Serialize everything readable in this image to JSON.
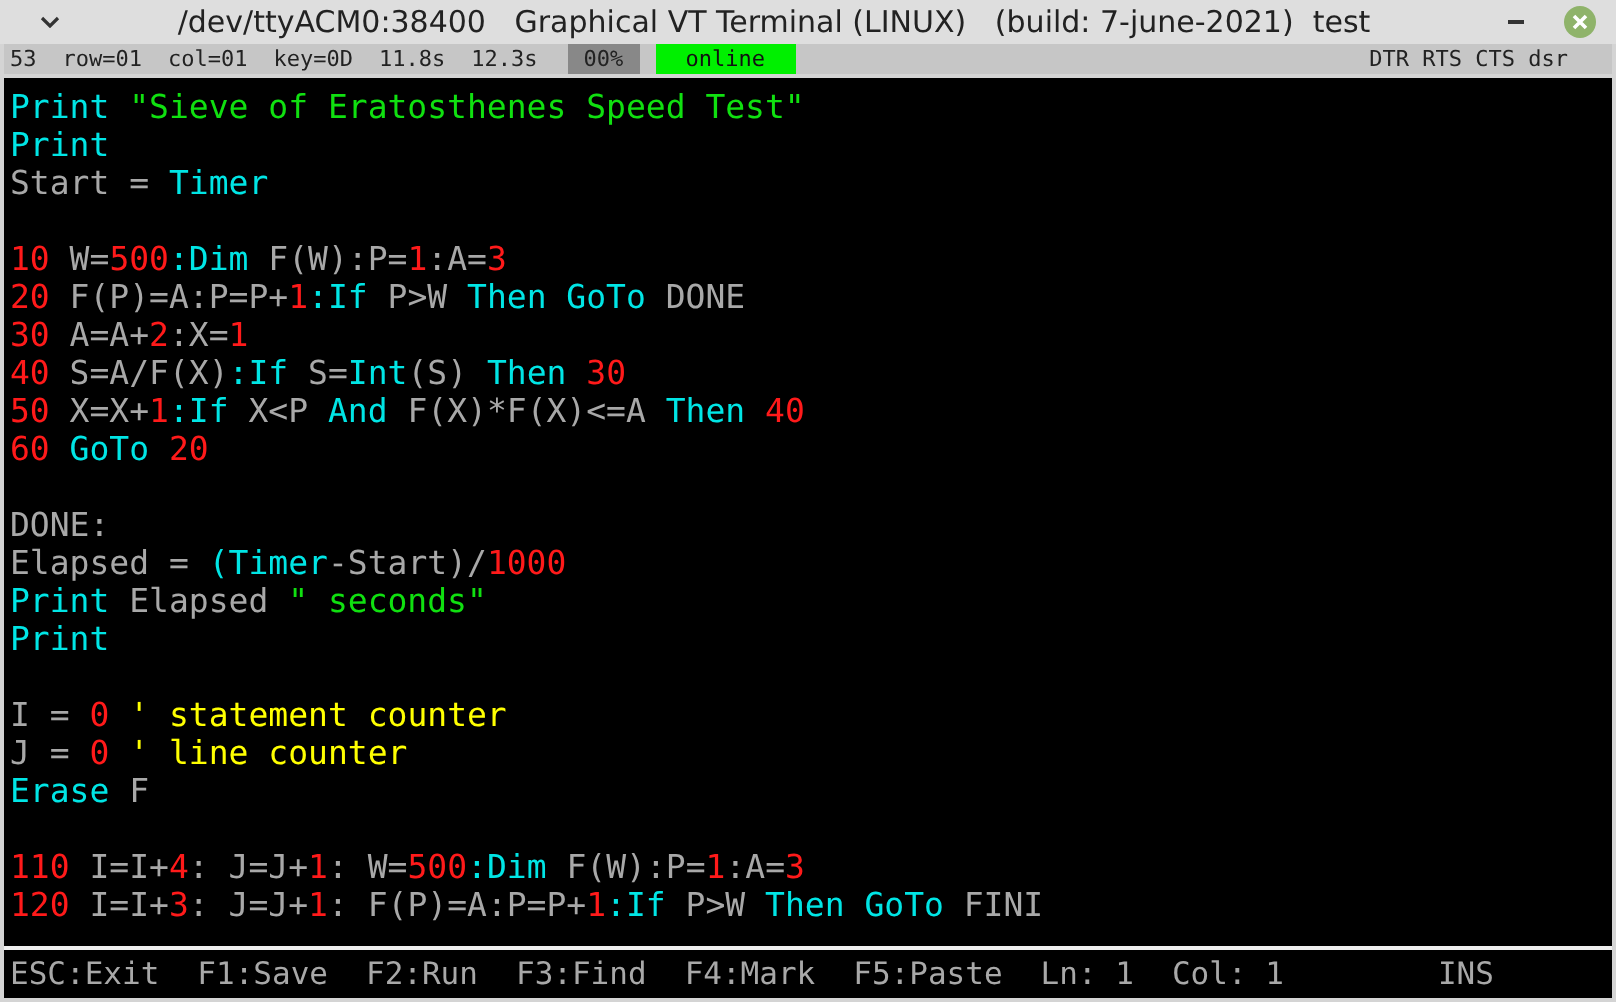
{
  "window": {
    "title": "/dev/ttyACM0:38400   Graphical VT Terminal (LINUX)   (build: 7-june-2021)  test"
  },
  "status_bar": {
    "fields": [
      "53",
      "row=01",
      "col=01",
      "key=0D",
      "11.8s",
      "12.3s"
    ],
    "progress": "00%",
    "connection": "online",
    "signals": "DTR RTS CTS dsr"
  },
  "editor": {
    "blocks": [
      {
        "lines": [
          [
            {
              "text": "Print ",
              "kind": "keyword"
            },
            {
              "text": "\"Sieve of Eratosthenes Speed Test\"",
              "kind": "string"
            }
          ],
          [
            {
              "text": "Print",
              "kind": "keyword"
            }
          ],
          [
            {
              "text": "Start = ",
              "kind": "plain"
            },
            {
              "text": "Timer",
              "kind": "keyword"
            }
          ]
        ]
      },
      {
        "lines": [
          [
            {
              "text": "10",
              "kind": "number"
            },
            {
              "text": " W=",
              "kind": "plain"
            },
            {
              "text": "500",
              "kind": "number"
            },
            {
              "text": ":Dim",
              "kind": "keyword"
            },
            {
              "text": " F(W):P=",
              "kind": "plain"
            },
            {
              "text": "1",
              "kind": "number"
            },
            {
              "text": ":A=",
              "kind": "plain"
            },
            {
              "text": "3",
              "kind": "number"
            }
          ],
          [
            {
              "text": "20",
              "kind": "number"
            },
            {
              "text": " F(P)=A:P=P+",
              "kind": "plain"
            },
            {
              "text": "1",
              "kind": "number"
            },
            {
              "text": ":If",
              "kind": "keyword"
            },
            {
              "text": " P>W ",
              "kind": "plain"
            },
            {
              "text": "Then GoTo",
              "kind": "keyword"
            },
            {
              "text": " DONE",
              "kind": "plain"
            }
          ],
          [
            {
              "text": "30",
              "kind": "number"
            },
            {
              "text": " A=A+",
              "kind": "plain"
            },
            {
              "text": "2",
              "kind": "number"
            },
            {
              "text": ":X=",
              "kind": "plain"
            },
            {
              "text": "1",
              "kind": "number"
            }
          ],
          [
            {
              "text": "40",
              "kind": "number"
            },
            {
              "text": " S=A/F(X)",
              "kind": "plain"
            },
            {
              "text": ":If",
              "kind": "keyword"
            },
            {
              "text": " S=",
              "kind": "plain"
            },
            {
              "text": "Int",
              "kind": "keyword"
            },
            {
              "text": "(S) ",
              "kind": "plain"
            },
            {
              "text": "Then",
              "kind": "keyword"
            },
            {
              "text": " 30",
              "kind": "number"
            }
          ],
          [
            {
              "text": "50",
              "kind": "number"
            },
            {
              "text": " X=X+",
              "kind": "plain"
            },
            {
              "text": "1",
              "kind": "number"
            },
            {
              "text": ":If",
              "kind": "keyword"
            },
            {
              "text": " X<P ",
              "kind": "plain"
            },
            {
              "text": "And",
              "kind": "keyword"
            },
            {
              "text": " F(X)*F(X)<=A ",
              "kind": "plain"
            },
            {
              "text": "Then",
              "kind": "keyword"
            },
            {
              "text": " 40",
              "kind": "number"
            }
          ],
          [
            {
              "text": "60",
              "kind": "number"
            },
            {
              "text": " GoTo",
              "kind": "keyword"
            },
            {
              "text": " 20",
              "kind": "number"
            }
          ]
        ]
      },
      {
        "lines": [
          [
            {
              "text": "DONE:",
              "kind": "plain"
            }
          ],
          [
            {
              "text": "Elapsed = ",
              "kind": "plain"
            },
            {
              "text": "(Timer",
              "kind": "keyword"
            },
            {
              "text": "-Start)/",
              "kind": "plain"
            },
            {
              "text": "1000",
              "kind": "number"
            }
          ],
          [
            {
              "text": "Print",
              "kind": "keyword"
            },
            {
              "text": " Elapsed ",
              "kind": "plain"
            },
            {
              "text": "\" seconds\"",
              "kind": "string"
            }
          ],
          [
            {
              "text": "Print",
              "kind": "keyword"
            }
          ]
        ]
      },
      {
        "lines": [
          [
            {
              "text": "I = ",
              "kind": "plain"
            },
            {
              "text": "0",
              "kind": "number"
            },
            {
              "text": " ' statement counter",
              "kind": "comment"
            }
          ],
          [
            {
              "text": "J = ",
              "kind": "plain"
            },
            {
              "text": "0",
              "kind": "number"
            },
            {
              "text": " ' line counter",
              "kind": "comment"
            }
          ],
          [
            {
              "text": "Erase",
              "kind": "keyword"
            },
            {
              "text": " F",
              "kind": "plain"
            }
          ]
        ]
      },
      {
        "lines": [
          [
            {
              "text": "110",
              "kind": "number"
            },
            {
              "text": " I=I+",
              "kind": "plain"
            },
            {
              "text": "4",
              "kind": "number"
            },
            {
              "text": ": J=J+",
              "kind": "plain"
            },
            {
              "text": "1",
              "kind": "number"
            },
            {
              "text": ": W=",
              "kind": "plain"
            },
            {
              "text": "500",
              "kind": "number"
            },
            {
              "text": ":Dim",
              "kind": "keyword"
            },
            {
              "text": " F(W):P=",
              "kind": "plain"
            },
            {
              "text": "1",
              "kind": "number"
            },
            {
              "text": ":A=",
              "kind": "plain"
            },
            {
              "text": "3",
              "kind": "number"
            }
          ],
          [
            {
              "text": "120",
              "kind": "number"
            },
            {
              "text": " I=I+",
              "kind": "plain"
            },
            {
              "text": "3",
              "kind": "number"
            },
            {
              "text": ": J=J+",
              "kind": "plain"
            },
            {
              "text": "1",
              "kind": "number"
            },
            {
              "text": ": F(P)=A:P=P+",
              "kind": "plain"
            },
            {
              "text": "1",
              "kind": "number"
            },
            {
              "text": ":If",
              "kind": "keyword"
            },
            {
              "text": " P>W ",
              "kind": "plain"
            },
            {
              "text": "Then GoTo",
              "kind": "keyword"
            },
            {
              "text": " FINI",
              "kind": "plain"
            }
          ]
        ]
      }
    ]
  },
  "footer": {
    "keys": [
      "ESC:Exit",
      "F1:Save",
      "F2:Run",
      "F3:Find",
      "F4:Mark",
      "F5:Paste"
    ],
    "line": "Ln: 1",
    "column": "Col: 1",
    "mode": "INS"
  }
}
